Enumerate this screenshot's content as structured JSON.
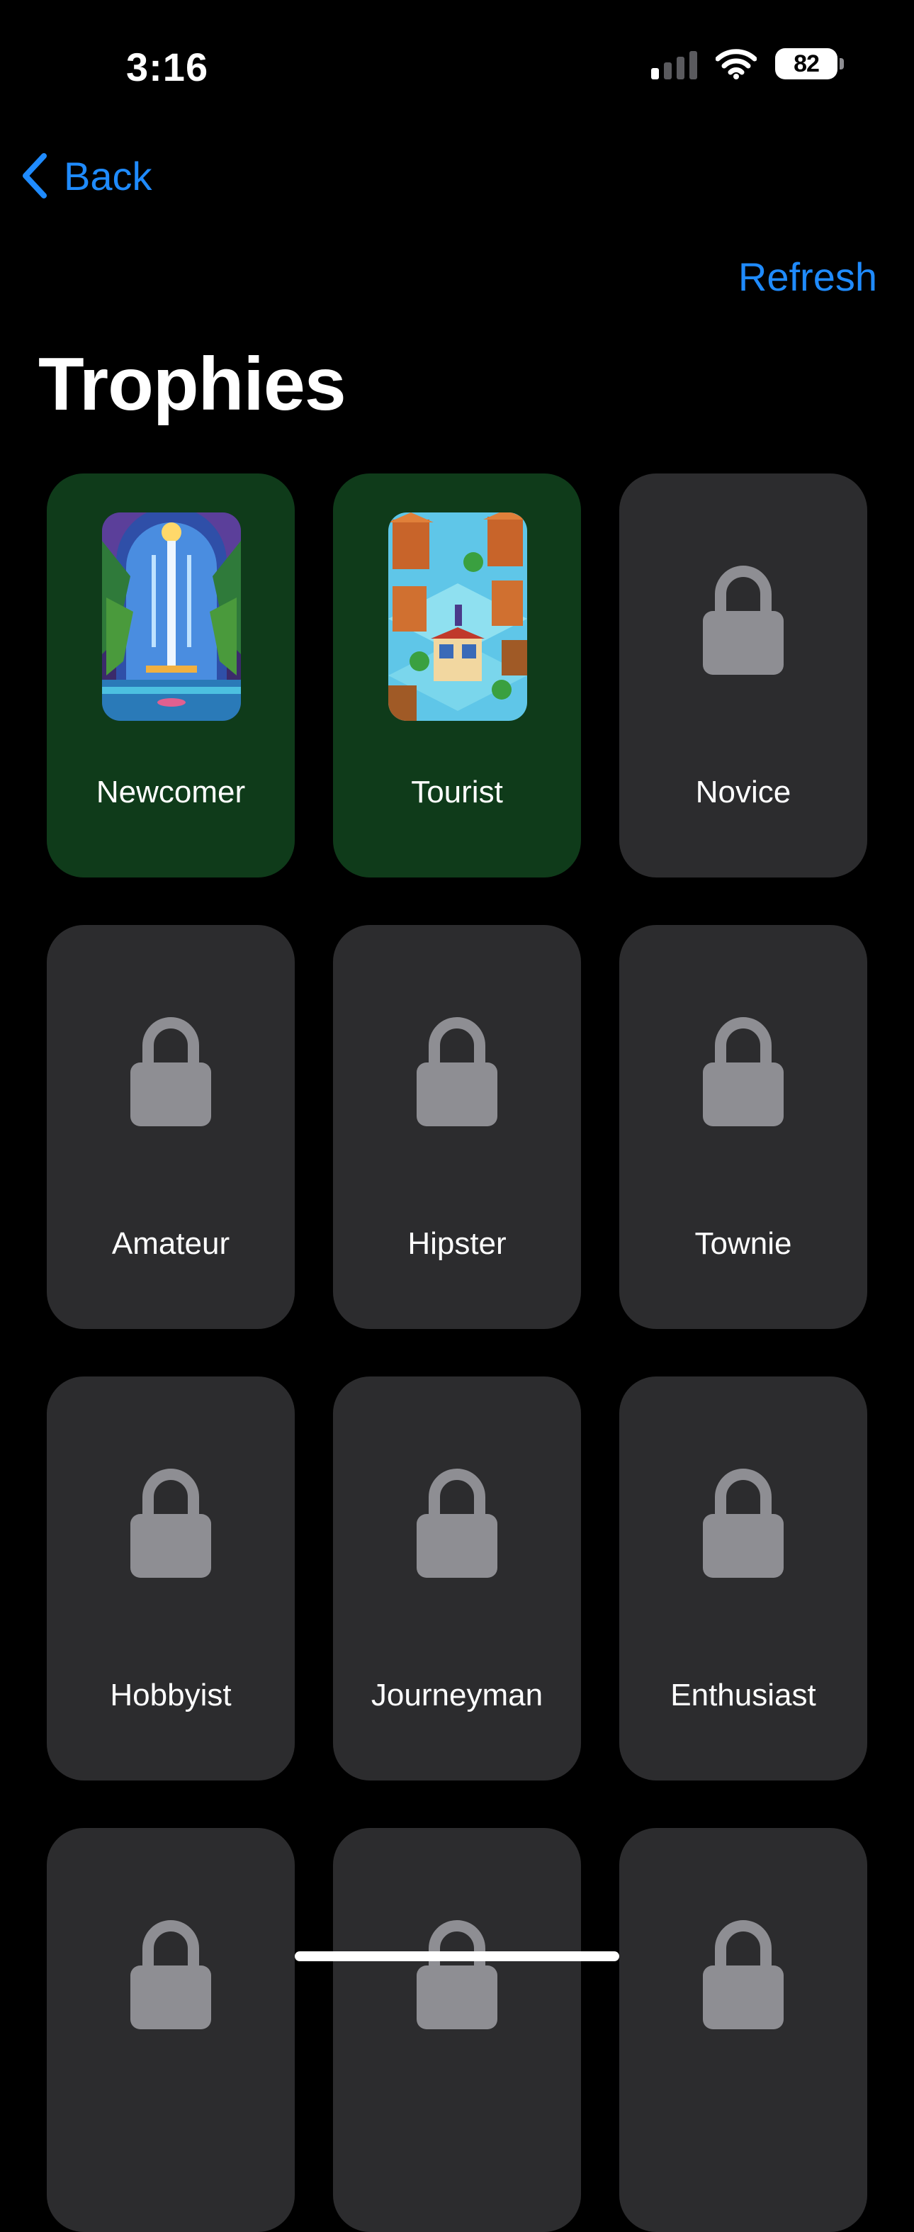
{
  "status_bar": {
    "time": "3:16",
    "battery": "82",
    "icons": [
      "signal-icon",
      "wifi-icon",
      "battery-icon"
    ]
  },
  "nav": {
    "back_label": "Back",
    "refresh_label": "Refresh"
  },
  "page": {
    "title": "Trophies"
  },
  "trophies": [
    {
      "label": "Newcomer",
      "state": "unlocked",
      "image": "waterfall-pixel-art"
    },
    {
      "label": "Tourist",
      "state": "unlocked",
      "image": "isometric-town-pixel-art"
    },
    {
      "label": "Novice",
      "state": "locked"
    },
    {
      "label": "Amateur",
      "state": "locked"
    },
    {
      "label": "Hipster",
      "state": "locked"
    },
    {
      "label": "Townie",
      "state": "locked"
    },
    {
      "label": "Hobbyist",
      "state": "locked"
    },
    {
      "label": "Journeyman",
      "state": "locked"
    },
    {
      "label": "Enthusiast",
      "state": "locked"
    },
    {
      "label": "",
      "state": "locked"
    },
    {
      "label": "",
      "state": "locked"
    },
    {
      "label": "",
      "state": "locked"
    }
  ],
  "colors": {
    "background": "#000000",
    "accent": "#1f8bff",
    "card_locked": "#2c2c2e",
    "card_unlocked": "#0f3b1a",
    "lock": "#8e8e93"
  }
}
